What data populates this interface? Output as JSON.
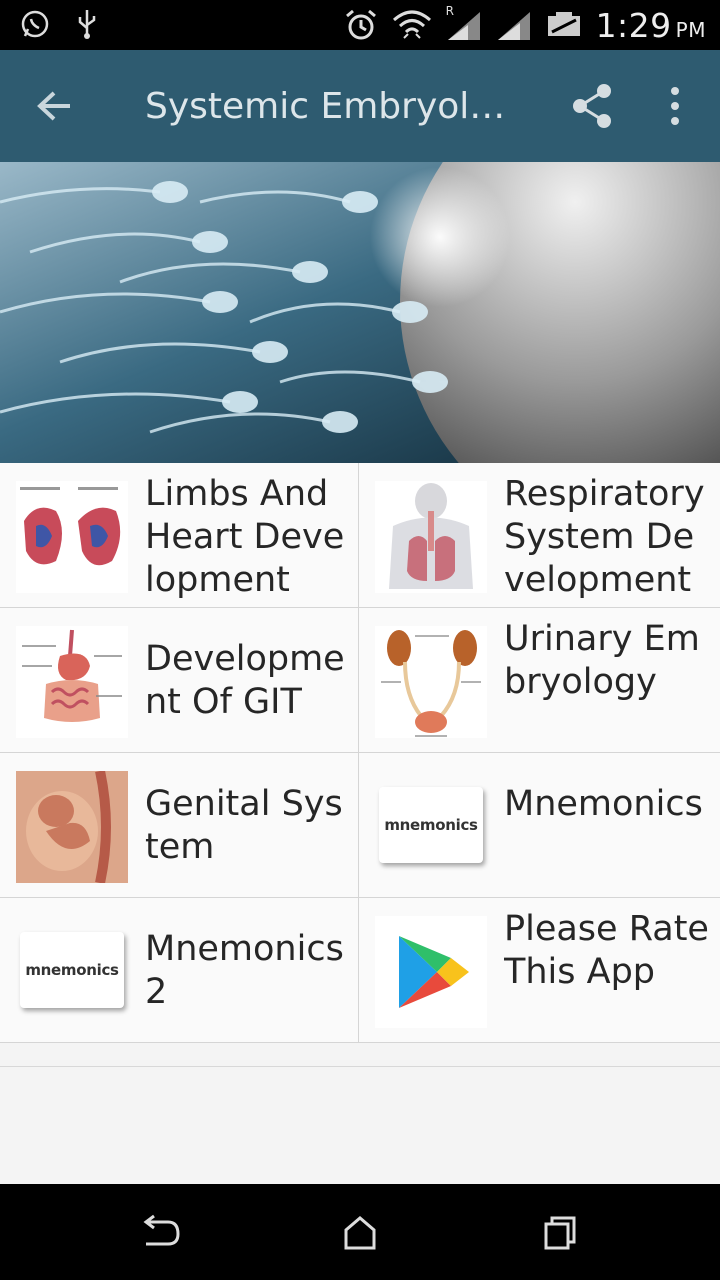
{
  "toolbar": {
    "title": "Systemic Embryology"
  },
  "status_bar": {
    "time": "1:29",
    "ampm": "PM",
    "roaming": "R"
  },
  "grid": [
    {
      "label": "Limbs And Heart Development",
      "thumb": "heart-diagram"
    },
    {
      "label": "Respiratory System Development",
      "thumb": "respiratory-diagram"
    },
    {
      "label": "Development Of GIT",
      "thumb": "git-diagram"
    },
    {
      "label": "Urinary Embryology",
      "thumb": "urinary-diagram"
    },
    {
      "label": "Genital System",
      "thumb": "fetus-image"
    },
    {
      "label": "Mnemonics",
      "thumb": "mnemonics-logo"
    },
    {
      "label": "Mnemonics 2",
      "thumb": "mnemonics-logo"
    },
    {
      "label": "Please Rate This App",
      "thumb": "play-store-logo"
    }
  ],
  "mnemonics_logo_text": "mnemonics",
  "colors": {
    "toolbar": "#2e5b70",
    "statusbar": "#000000",
    "navbar": "#000000"
  }
}
